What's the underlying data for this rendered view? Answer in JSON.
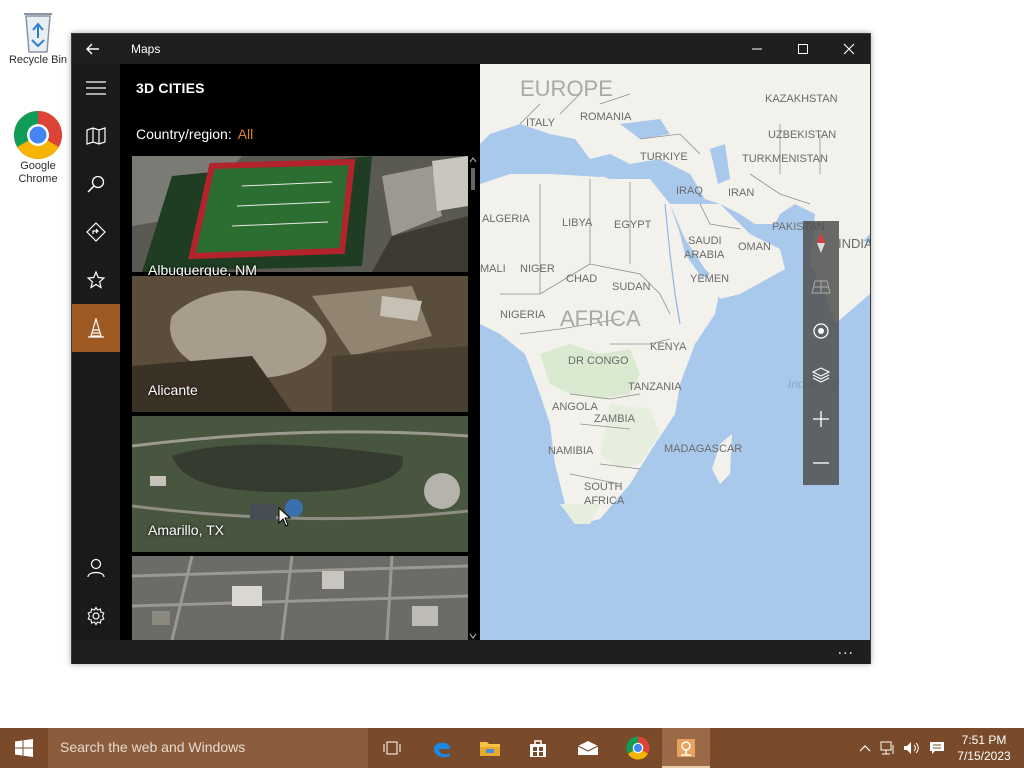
{
  "desktop": {
    "icons": [
      {
        "label": "Recycle Bin"
      },
      {
        "label": "Google Chrome"
      }
    ]
  },
  "window": {
    "title": "Maps",
    "nav": [
      "map",
      "search",
      "directions",
      "favorites",
      "3d-cities",
      "account",
      "settings"
    ]
  },
  "panel": {
    "title": "3D CITIES",
    "country_label": "Country/region:",
    "country_value": "All",
    "cities": [
      {
        "name": "Albuquerque, NM"
      },
      {
        "name": "Alicante"
      },
      {
        "name": "Amarillo, TX"
      },
      {
        "name": ""
      }
    ]
  },
  "map": {
    "labels": {
      "europe": "EUROPE",
      "kazakhstan": "KAZAKHSTAN",
      "romania": "ROMANIA",
      "italy": "ITALY",
      "uzbekistan": "UZBEKISTAN",
      "turkiye": "TURKIYE",
      "turkmenistan": "TURKMENISTAN",
      "iraq": "IRAQ",
      "iran": "IRAN",
      "algeria": "ALGERIA",
      "libya": "LIBYA",
      "egypt": "EGYPT",
      "pakistan": "PAKISTAN",
      "india": "INDIA",
      "saudi1": "SAUDI",
      "saudi2": "ARABIA",
      "oman": "OMAN",
      "mali": "MALI",
      "niger": "NIGER",
      "chad": "CHAD",
      "yemen": "YEMEN",
      "sudan": "SUDAN",
      "nigeria": "NIGERIA",
      "africa": "AFRICA",
      "drcongo": "DR CONGO",
      "kenya": "KENYA",
      "indianocean": "Indian Oc",
      "tanzania": "TANZANIA",
      "angola": "ANGOLA",
      "zambia": "ZAMBIA",
      "namibia": "NAMIBIA",
      "madagascar": "MADAGASCAR",
      "southafrica1": "SOUTH",
      "southafrica2": "AFRICA"
    },
    "controls": [
      "compass",
      "tilt",
      "location",
      "layers",
      "zoom-in",
      "zoom-out"
    ]
  },
  "appbar": {
    "more": "..."
  },
  "taskbar": {
    "search_placeholder": "Search the web and Windows",
    "time": "7:51 PM",
    "date": "7/15/2023"
  }
}
